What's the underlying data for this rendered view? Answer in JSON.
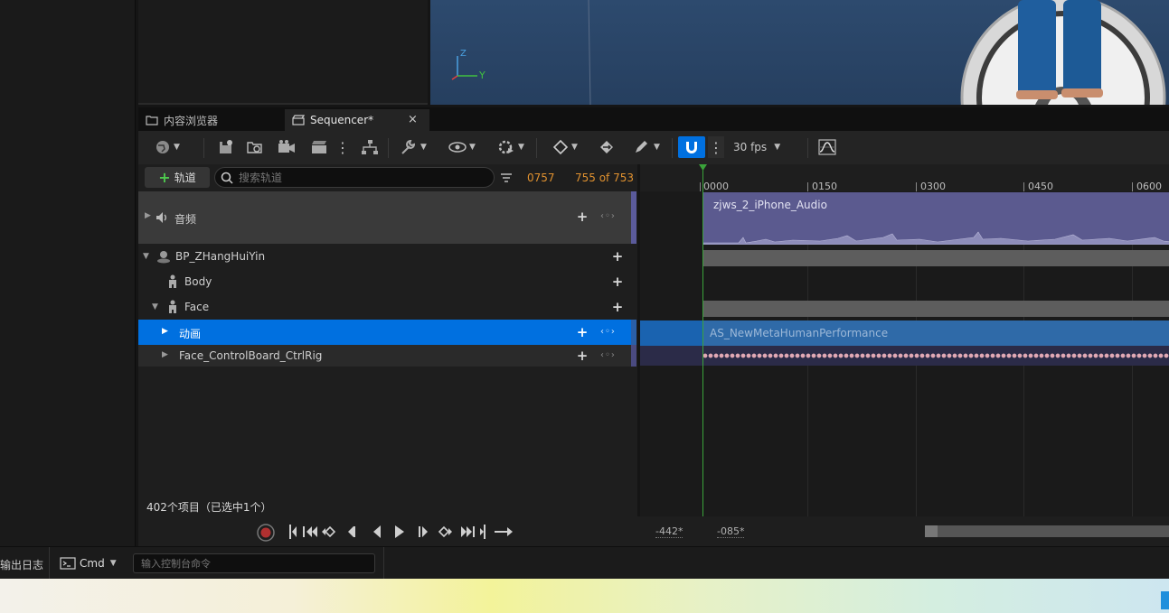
{
  "tabs": [
    {
      "label": "内容浏览器"
    },
    {
      "label": "Sequencer*"
    }
  ],
  "toolbar": {
    "fps_label": "30 fps"
  },
  "tracklist": {
    "add_track_label": "轨道",
    "search_placeholder": "搜索轨道",
    "current_frame": "0757",
    "frame_count": "755 of 753",
    "rows": [
      {
        "label": "音频"
      },
      {
        "label": "BP_ZHangHuiYin"
      },
      {
        "label": "Body"
      },
      {
        "label": "Face"
      },
      {
        "label": "动画"
      },
      {
        "label": "Face_ControlBoard_CtrlRig"
      }
    ],
    "item_count": "402个项目（已选中1个）"
  },
  "timeline": {
    "ticks": [
      "0000",
      "0150",
      "0300",
      "0450",
      "0600"
    ],
    "audio_clip_label": "zjws_2_iPhone_Audio",
    "anim_clip_label": "AS_NewMetaHumanPerformance",
    "range_start": "-442*",
    "range_end": "-085*"
  },
  "viewport": {
    "axis_z": "Z",
    "axis_y": "Y"
  },
  "statusbar": {
    "output_log_label": "输出日志",
    "cmd_label": "Cmd",
    "console_placeholder": "输入控制台命令"
  },
  "colors": {
    "selection": "#0070e0",
    "audio_clip": "#5b5a8f",
    "anim_clip": "#2f6aa8",
    "playhead": "#3aa33a",
    "frame_orange": "#e0912f"
  }
}
